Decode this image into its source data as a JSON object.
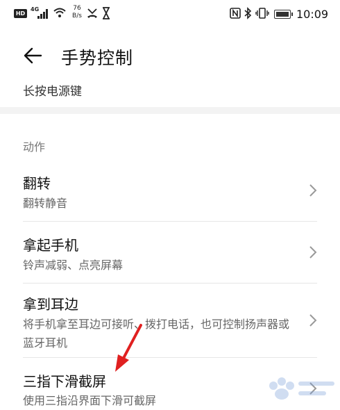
{
  "status": {
    "hd": "HD",
    "network": "4G",
    "speed_value": "76",
    "speed_unit": "B/s",
    "time": "10:09"
  },
  "header": {
    "title": "手势控制"
  },
  "previous_item": "长按电源键",
  "section_title": "动作",
  "items": [
    {
      "title": "翻转",
      "subtitle": "翻转静音"
    },
    {
      "title": "拿起手机",
      "subtitle": "铃声减弱、点亮屏幕"
    },
    {
      "title": "拿到耳边",
      "subtitle": "将手机拿至耳边可接听、拨打电话，也可控制扬声器或蓝牙耳机"
    },
    {
      "title": "三指下滑截屏",
      "subtitle": "使用三指沿界面下滑可截屏"
    }
  ],
  "annotation": {
    "color": "#e02020"
  }
}
